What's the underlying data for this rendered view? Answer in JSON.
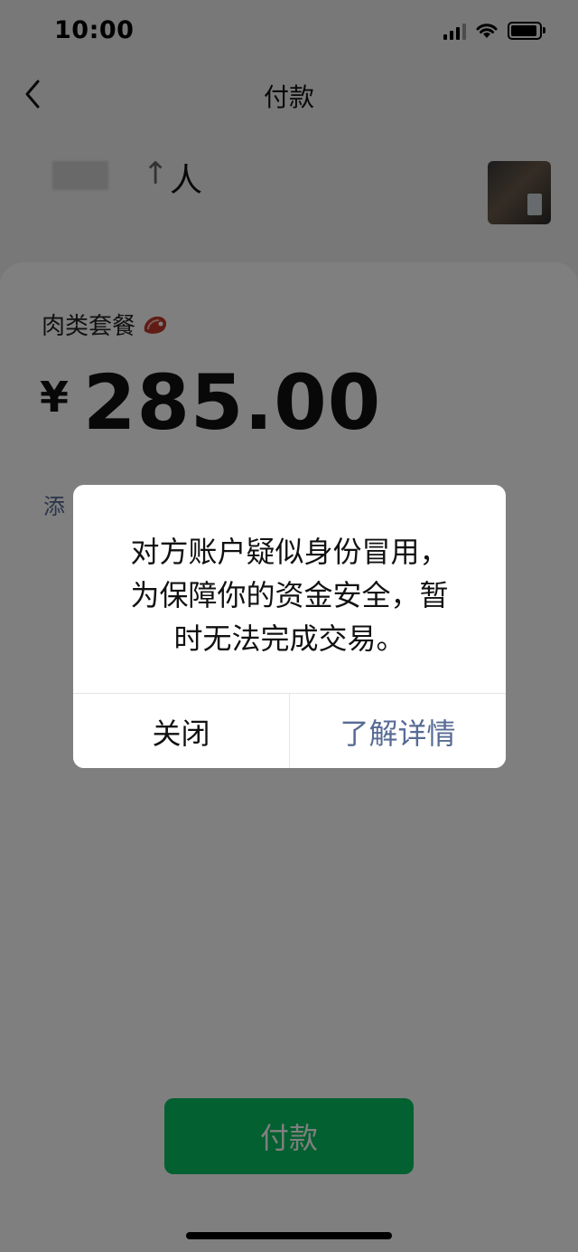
{
  "status_bar": {
    "time": "10:00"
  },
  "nav": {
    "title": "付款"
  },
  "payee": {
    "name_suffix": "人",
    "arrow_glyph": "↑"
  },
  "payment": {
    "note": "肉类套餐",
    "currency_symbol": "¥",
    "amount": "285.00",
    "add_note_partial": "添"
  },
  "pay_button": {
    "label": "付款"
  },
  "dialog": {
    "message_lines": [
      "对方账户疑似身份冒用，",
      "为保障你的资金安全，暂",
      "时无法完成交易。"
    ],
    "close_label": "关闭",
    "learn_more_label": "了解详情"
  },
  "colors": {
    "accent_green": "#07c160",
    "link_blue": "#576b95"
  },
  "icons": [
    "back-chevron-icon",
    "signal-icon",
    "wifi-icon",
    "battery-icon",
    "meat-emoji-icon"
  ]
}
